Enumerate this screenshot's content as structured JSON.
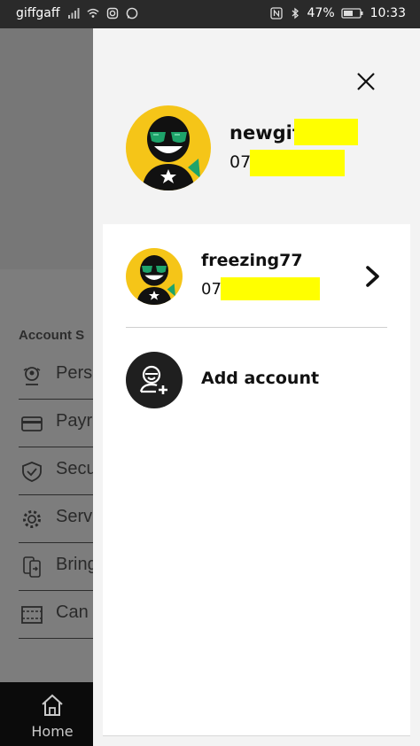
{
  "status_bar": {
    "carrier": "giffgaff",
    "battery": "47%",
    "time": "10:33"
  },
  "background_page": {
    "section_title": "Account S",
    "menu_items": [
      {
        "label": "Pers",
        "icon": "profile-icon"
      },
      {
        "label": "Payr",
        "icon": "card-icon"
      },
      {
        "label": "Secu",
        "icon": "shield-icon"
      },
      {
        "label": "Serv",
        "icon": "gear-icon"
      },
      {
        "label": "Bring",
        "icon": "phone-transfer-icon"
      },
      {
        "label": "Can",
        "icon": "cancel-icon"
      }
    ],
    "bottom_nav": {
      "home_label": "Home"
    }
  },
  "drawer": {
    "current_account": {
      "name": "newgif",
      "number": "07"
    },
    "accounts": [
      {
        "name": "freezing77",
        "number": "07"
      }
    ],
    "add_account_label": "Add account"
  },
  "colors": {
    "brand_yellow": "#F5C518",
    "redaction": "#FFFF00",
    "accent_green": "#1EA36A"
  }
}
